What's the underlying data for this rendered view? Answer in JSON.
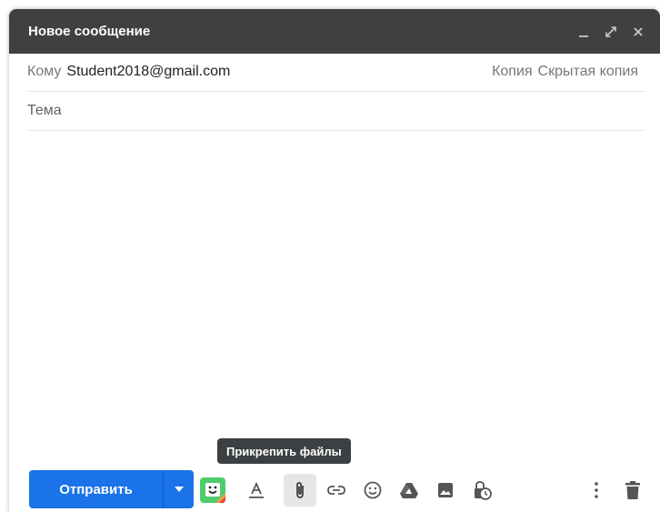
{
  "window": {
    "title": "Новое сообщение"
  },
  "compose": {
    "to_label": "Кому",
    "to_value": "Student2018@gmail.com",
    "cc_label": "Копия",
    "bcc_label": "Скрытая копия",
    "subject_placeholder": "Тема"
  },
  "toolbar": {
    "send_label": "Отправить",
    "tooltip": "Прикрепить файлы",
    "icons": [
      "bitmoji-icon",
      "format-text-icon",
      "attach-icon",
      "link-icon",
      "emoji-icon",
      "drive-icon",
      "image-icon",
      "confidential-icon",
      "more-options-icon",
      "trash-icon"
    ]
  },
  "colors": {
    "titlebar": "#404040",
    "send": "#1a73e8",
    "tooltip": "#3c4043",
    "icon": "#555555"
  }
}
